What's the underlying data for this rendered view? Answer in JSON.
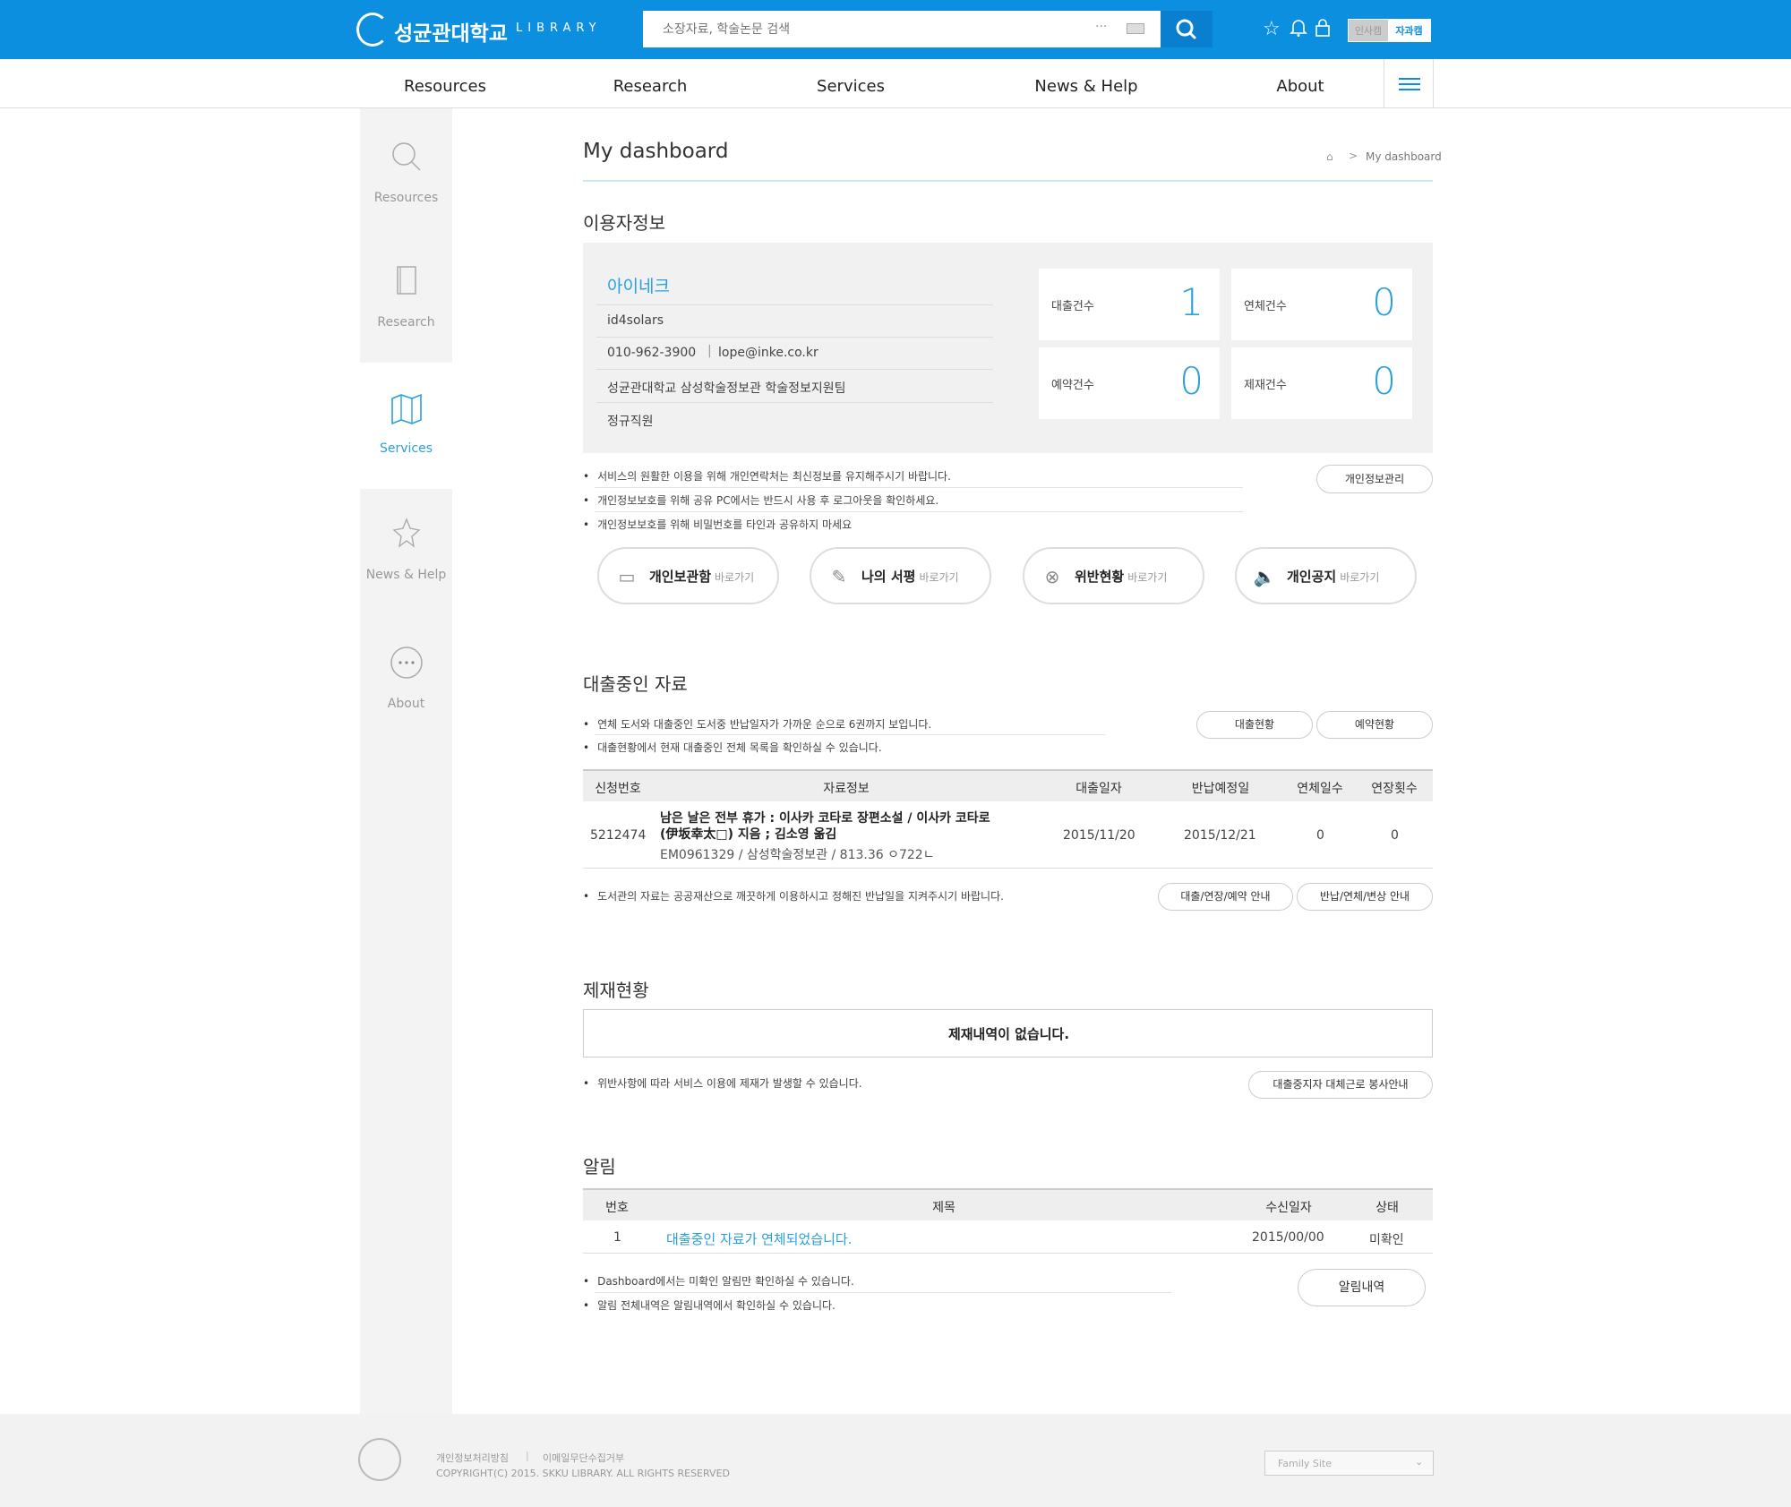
{
  "header": {
    "logo_text": "성균관대학교",
    "logo_sub": "LIBRARY",
    "search_placeholder": "소장자료, 학술논문 검색",
    "search_dots": "···",
    "lang_ko": "인사캠",
    "lang_current": "자과캠"
  },
  "gnb": [
    "Resources",
    "Research",
    "Services",
    "News & Help",
    "About"
  ],
  "sidebar": [
    "Resources",
    "Research",
    "Services",
    "News & Help",
    "About"
  ],
  "page": {
    "title": "My dashboard",
    "breadcrumb_sep": ">",
    "breadcrumb_current": "My dashboard"
  },
  "user": {
    "section_title": "이용자정보",
    "name": "아이네크",
    "id": "id4solars",
    "phone": "010-962-3900",
    "email": "lope@inke.co.kr",
    "dept": "성균관대학교 삼성학술정보관 학술정보지원팀",
    "type": "정규직원",
    "stats": [
      {
        "label": "대출건수",
        "value": "1"
      },
      {
        "label": "연체건수",
        "value": "0"
      },
      {
        "label": "예약건수",
        "value": "0"
      },
      {
        "label": "제재건수",
        "value": "0"
      }
    ],
    "notes": [
      "서비스의 원활한 이용을 위해 개인연락처는 최신정보를 유지해주시기 바랍니다.",
      "개인정보보호를 위해 공유 PC에서는 반드시 사용 후 로그아웃을 확인하세요.",
      "개인정보보호를 위해 비밀번호를 타인과 공유하지 마세요"
    ],
    "manage_btn": "개인정보관리",
    "shortcuts": [
      {
        "title": "개인보관함",
        "sub": "바로가기"
      },
      {
        "title": "나의 서평",
        "sub": "바로가기"
      },
      {
        "title": "위반현황",
        "sub": "바로가기"
      },
      {
        "title": "개인공지",
        "sub": "바로가기"
      }
    ]
  },
  "loans": {
    "section_title": "대출중인 자료",
    "notes": [
      "연체 도서와 대출중인 도서중 반납일자가 가까운 순으로 6권까지 보입니다.",
      "대출현황에서 현재 대출중인 전체 목록을 확인하실 수 있습니다."
    ],
    "btn_status": "대출현황",
    "btn_reserve": "예약현황",
    "columns": [
      "신청번호",
      "자료정보",
      "대출일자",
      "반납예정일",
      "연체일수",
      "연장횟수"
    ],
    "rows": [
      {
        "no": "5212474",
        "title_line1": "남은 날은 전부 휴가 : 이사카 코타로 장편소설 / 이사카 코타로",
        "title_line2": "(伊坂幸太□) 지음 ; 김소영 옮김",
        "call": "EM0961329 / 삼성학술정보관 / 813.36 ㅇ722ㄴ",
        "loan_date": "2015/11/20",
        "due_date": "2015/12/21",
        "overdue": "0",
        "renew": "0"
      }
    ],
    "bottom_note": "도서관의 자료는 공공재산으로 깨끗하게 이용하시고 정해진 반납일을 지켜주시기 바랍니다.",
    "btn_guide1": "대출/연장/예약 안내",
    "btn_guide2": "반납/연체/변상 안내"
  },
  "sanctions": {
    "section_title": "제재현황",
    "empty": "제재내역이 없습니다.",
    "note": "위반사항에 따라 서비스 이용에 제재가 발생할 수 있습니다.",
    "btn": "대출중지자 대체근로 봉사안내"
  },
  "alerts": {
    "section_title": "알림",
    "columns": [
      "번호",
      "제목",
      "수신일자",
      "상태"
    ],
    "rows": [
      {
        "no": "1",
        "title": "대출중인 자료가 연체되었습니다.",
        "date": "2015/00/00",
        "status": "미확인"
      }
    ],
    "notes": [
      "Dashboard에서는 미확인 알림만 확인하실 수 있습니다.",
      "알림 전체내역은 알림내역에서 확인하실 수 있습니다."
    ],
    "btn": "알림내역"
  },
  "footer": {
    "privacy": "개인정보처리방침",
    "sep": "|",
    "email_policy": "이메일무단수집거부",
    "copyright": "COPYRIGHT(C) 2015. SKKU LIBRARY. ALL RIGHTS RESERVED",
    "family_site": "Family Site"
  },
  "colors": {
    "brand": "#0d8fe0",
    "accent": "#2aa0dc"
  }
}
